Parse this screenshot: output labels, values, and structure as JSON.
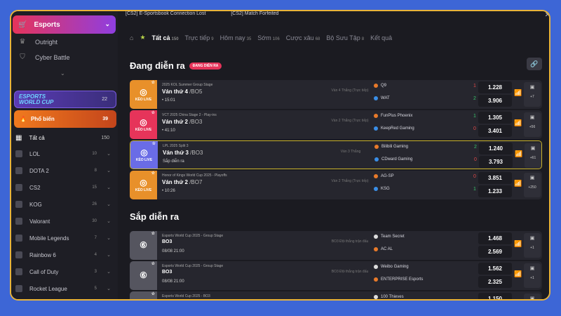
{
  "notice": {
    "msg1": "[CS2] E-Sportsbook Connection Lost",
    "msg2": "[CS2] Match Forfeited",
    "close": "✕"
  },
  "sidebar": {
    "top_label": "Esports",
    "sub_items": [
      {
        "label": "Outright",
        "icon": "trophy-icon"
      },
      {
        "label": "Cyber Battle",
        "icon": "shield-icon"
      }
    ],
    "ewc": {
      "logo1": "ESPORTS",
      "logo2": "WORLD CUP",
      "count": "22"
    },
    "hot": {
      "label": "Phổ biến",
      "count": "39"
    },
    "all": {
      "label": "Tất cả",
      "count": "150"
    },
    "games": [
      {
        "label": "LOL",
        "count": "10"
      },
      {
        "label": "DOTA 2",
        "count": "8"
      },
      {
        "label": "CS2",
        "count": "15"
      },
      {
        "label": "KOG",
        "count": "26"
      },
      {
        "label": "Valorant",
        "count": "30"
      },
      {
        "label": "Mobile Legends",
        "count": "7"
      },
      {
        "label": "Rainbow 6",
        "count": "4"
      },
      {
        "label": "Call of Duty",
        "count": "3"
      },
      {
        "label": "Rocket League",
        "count": "5"
      }
    ]
  },
  "tabs": [
    {
      "label": "Tất cả",
      "count": "150",
      "active": true
    },
    {
      "label": "Trực tiếp",
      "count": "9"
    },
    {
      "label": "Hôm nay",
      "count": "35"
    },
    {
      "label": "Sớm",
      "count": "106"
    },
    {
      "label": "Cược xâu",
      "count": "68"
    },
    {
      "label": "Bộ Sưu Tập",
      "count": "8"
    },
    {
      "label": "Kết quả",
      "count": ""
    }
  ],
  "live_section": {
    "title": "Đang diễn ra",
    "badge": "ĐANG DIỄN RA"
  },
  "upcoming_section": {
    "title": "Sắp diễn ra"
  },
  "live_matches": [
    {
      "league": "2025 KOL Summer Group Stage",
      "round": "Ván thứ 4",
      "fmt": "/BO5",
      "time": "• 15:01",
      "meta": "Ván 4 Thắng (Trực tiếp)",
      "kicon": "KÈO LIVE",
      "team1": "Q9",
      "team2": "WAT",
      "s1": "1",
      "s2": "2",
      "o1": "1.228",
      "o2": "3.906",
      "more": "+7",
      "color": "#e8902a"
    },
    {
      "league": "VCT 2025 China Stage 2 - Play-ins",
      "round": "Ván thứ 2",
      "fmt": "/BO3",
      "time": "• 41:10",
      "meta": "Ván 2 Thắng (Trực tiếp)",
      "kicon": "KÈO LIVE",
      "team1": "FunPlus Phoenix",
      "team2": "KeepRed Gaming",
      "s1": "1",
      "s2": "0",
      "o1": "1.305",
      "o2": "3.401",
      "more": "+56",
      "color": "#e6345a"
    },
    {
      "league": "LPL 2025 Split 3",
      "round": "Ván thứ 3",
      "fmt": "/BO3",
      "time": "Sắp diễn ra",
      "meta": "Ván 3 Thắng",
      "kicon": "KÈO LIVE",
      "team1": "Bilibili Gaming",
      "team2": "CDward Gaming",
      "s1": "2",
      "s2": "0",
      "o1": "1.240",
      "o2": "3.793",
      "more": "+61",
      "color": "#6a6ce6"
    },
    {
      "league": "Honor of Kings World Cup 2025 - Playoffs",
      "round": "Ván thứ 2",
      "fmt": "/BO7",
      "time": "• 10:26",
      "meta": "Ván 2 Thắng (Trực tiếp)",
      "kicon": "KÈO LIVE",
      "team1": "AG-SP",
      "team2": "KSG",
      "s1": "0",
      "s2": "1",
      "o1": "3.851",
      "o2": "1.233",
      "more": "+250",
      "color": "#e8902a"
    }
  ],
  "upcoming_matches": [
    {
      "league": "Esports World Cup 2025 - Group Stage",
      "round": "BO3",
      "time": "08/08 21:00",
      "meta": "BO3 Đội thắng trận đấu",
      "team1": "Team Secret",
      "team2": "AC AL",
      "o1": "1.468",
      "o2": "2.569",
      "more": "+1"
    },
    {
      "league": "Esports World Cup 2025 - Group Stage",
      "round": "BO3",
      "time": "08/08 21:00",
      "meta": "BO3 Đội thắng trận đấu",
      "team1": "Weibo Gaming",
      "team2": "ENTERPRISE Esports",
      "o1": "1.562",
      "o2": "2.325",
      "more": "+1"
    },
    {
      "league": "Esports World Cup 2025 - BO3",
      "round": "",
      "time": "",
      "meta": "",
      "team1": "100 Thieves",
      "team2": "",
      "o1": "1.150",
      "o2": "",
      "more": ""
    }
  ]
}
